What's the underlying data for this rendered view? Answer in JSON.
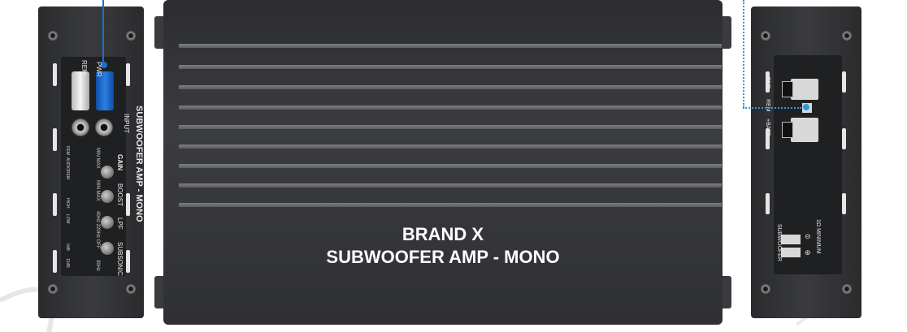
{
  "product": {
    "title_line1": "BRAND X",
    "title_line2": "SUBWOOFER AMP - MONO"
  },
  "input_panel": {
    "rca_labels": [
      "REM",
      "PWR"
    ],
    "side_label": "SUBWOOFER AMP - MONO",
    "input_label": "INPUT",
    "controls": {
      "gain": "GAIN",
      "gain_range": "MIN  MAX",
      "boost": "BOOST",
      "boost_range": "MIN  MAX",
      "lpf": "LPF",
      "lpf_range": "40Hz 220Hz OFF",
      "subsonic": "SUBSONIC",
      "subsonic_range": "30Hz"
    },
    "small_labels": [
      "REM",
      "AUDIO",
      "REM",
      "HIGH",
      "LOW",
      "0dB",
      "12dB"
    ]
  },
  "power_panel": {
    "gnd": "GND",
    "rem": "REM",
    "batt": "+BATT",
    "subwoofer": "SUBWOOFER",
    "minimum": "1Ω MINIMUM",
    "minus": "⊖",
    "plus": "⊕"
  },
  "colors": {
    "cable_blue": "#1a6fd0",
    "dotted_blue": "#2a9be0"
  }
}
